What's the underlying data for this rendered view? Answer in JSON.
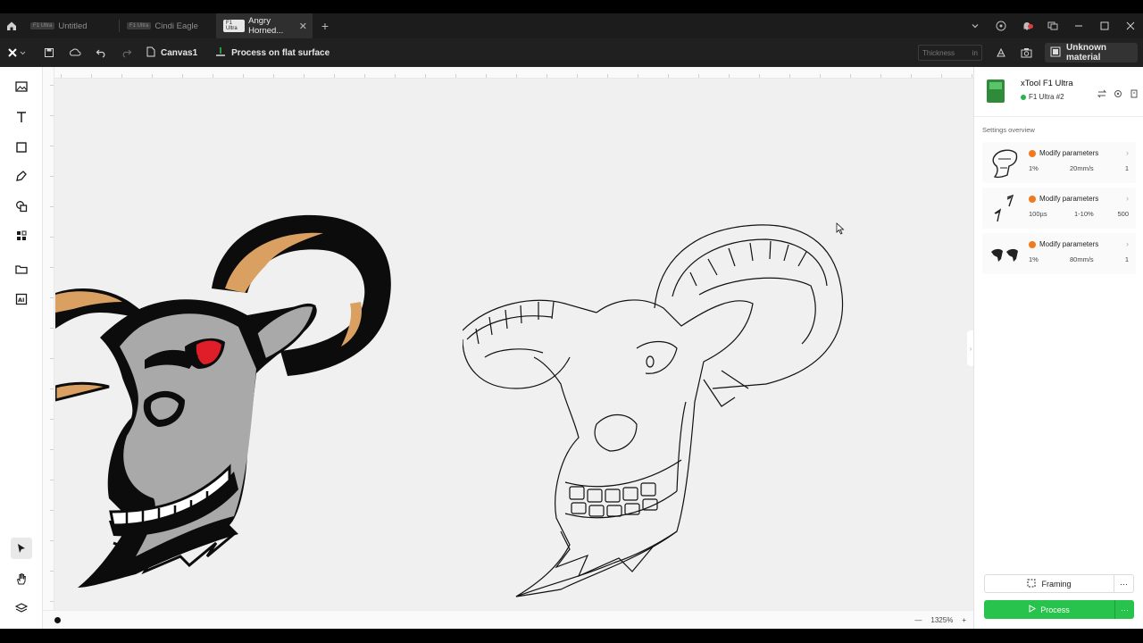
{
  "tabs": [
    {
      "badge": "F1 Ultra",
      "label": "Untitled",
      "active": false
    },
    {
      "badge": "F1 Ultra",
      "label": "Cindi Eagle",
      "active": false
    },
    {
      "badge": "F1 Ultra",
      "label": "Angry Horned...",
      "active": true
    }
  ],
  "toolbar": {
    "canvas_label": "Canvas1",
    "process_mode": "Process on flat surface",
    "thickness_placeholder": "Thickness",
    "thickness_unit": "in",
    "material": "Unknown material"
  },
  "device": {
    "name": "xTool F1 Ultra",
    "connection": "F1 Ultra #2",
    "status_color": "#2bb24c"
  },
  "settings": {
    "heading": "Settings overview",
    "cards": [
      {
        "title": "Modify parameters",
        "power": "1%",
        "speed": "20mm/s",
        "passes": "1"
      },
      {
        "title": "Modify parameters",
        "power": "100µs",
        "speed": "1-10%",
        "passes": "500"
      },
      {
        "title": "Modify parameters",
        "power": "1%",
        "speed": "80mm/s",
        "passes": "1"
      }
    ]
  },
  "actions": {
    "framing": "Framing",
    "process": "Process"
  },
  "status": {
    "zoom": "1325%"
  },
  "icons": {
    "left_tools": [
      "image-icon",
      "text-icon",
      "shape-icon",
      "pen-icon",
      "combine-icon",
      "elements-icon",
      "project-icon",
      "ai-icon",
      "select-icon",
      "hand-icon",
      "layers-icon"
    ]
  },
  "colors": {
    "process": "#28c34c",
    "warning": "#f07a20",
    "connected": "#2bb24c"
  }
}
